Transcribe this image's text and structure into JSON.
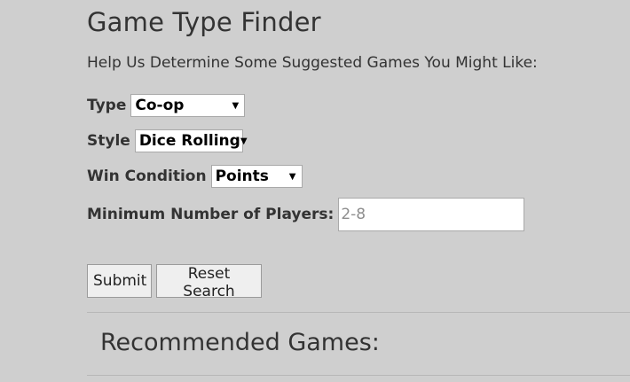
{
  "title": "Game Type Finder",
  "subtitle": "Help Us Determine Some Suggested Games You Might Like:",
  "form": {
    "type": {
      "label": "Type",
      "selected": "Co-op"
    },
    "style": {
      "label": "Style",
      "selected": "Dice Rolling"
    },
    "win_condition": {
      "label": "Win Condition",
      "selected": "Points"
    },
    "min_players": {
      "label": "Minimum Number of Players:",
      "value": "",
      "placeholder": "2-8"
    }
  },
  "buttons": {
    "submit": "Submit",
    "reset": "Reset Search"
  },
  "results": {
    "title": "Recommended Games:"
  },
  "icons": {
    "dropdown": "chevron-down-icon"
  }
}
